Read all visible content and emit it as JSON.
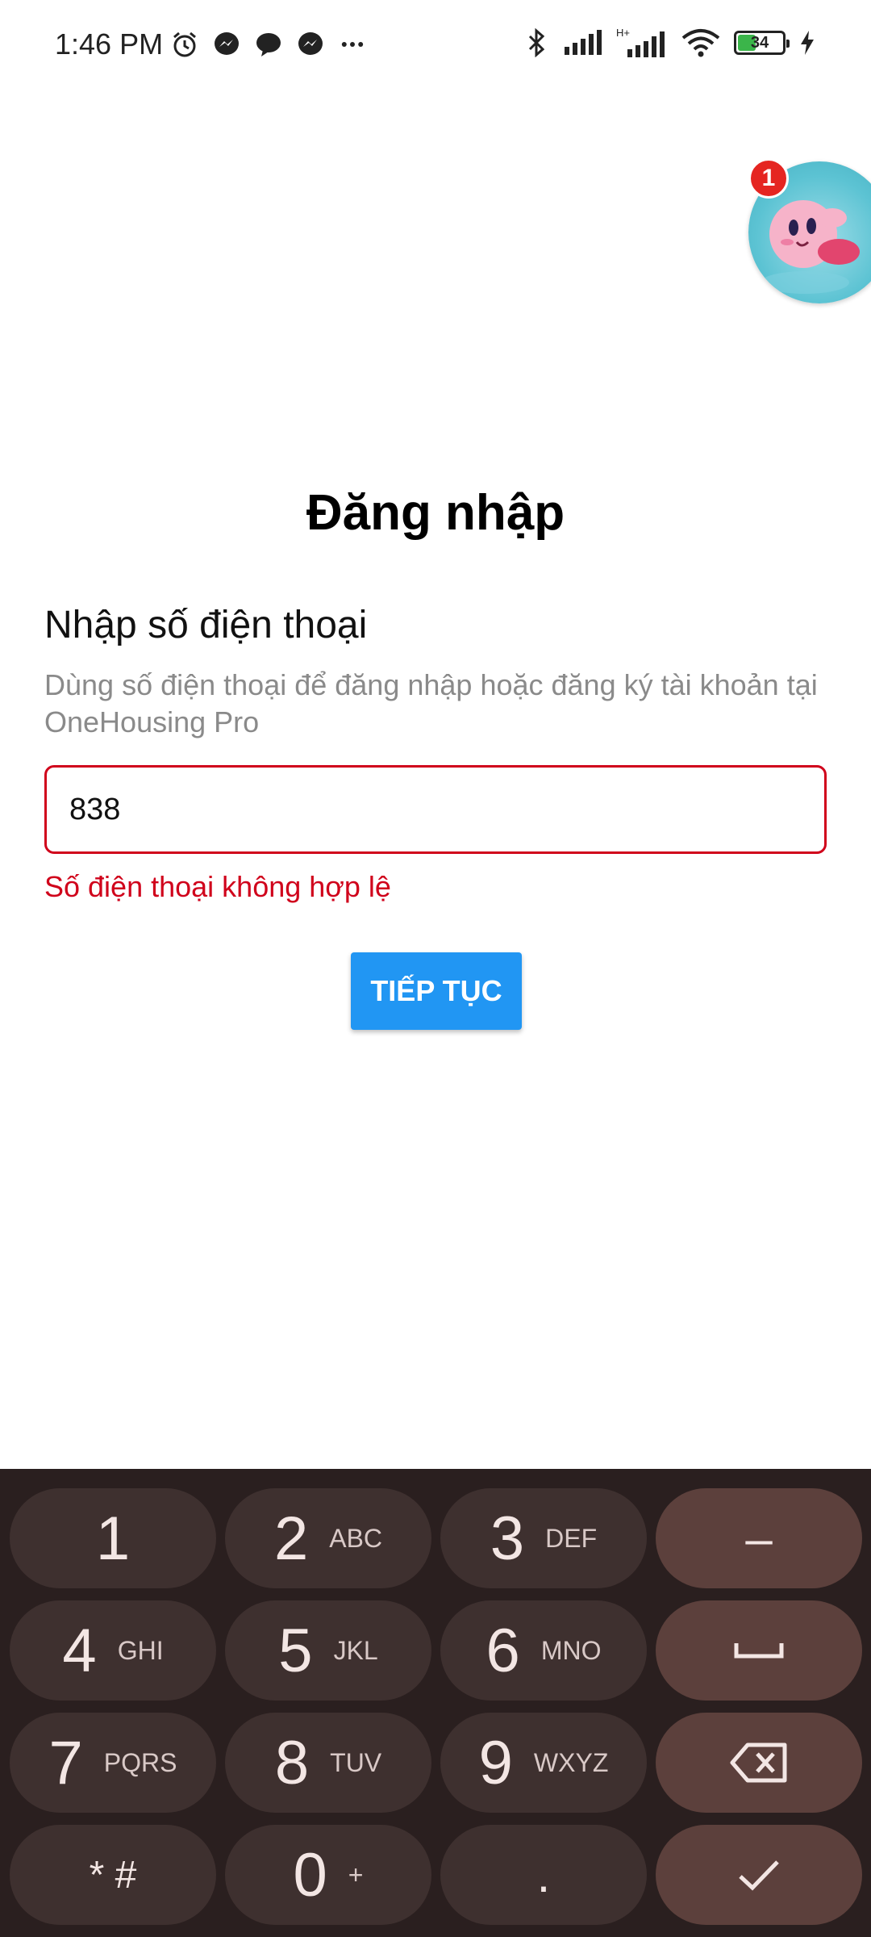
{
  "status_bar": {
    "time": "1:46 PM",
    "battery": "34",
    "left_icons": [
      "alarm-icon",
      "messenger-icon",
      "chat-icon",
      "messenger-icon",
      "more-icon"
    ],
    "right_icons": [
      "bluetooth-icon",
      "signal-icon",
      "hplus-signal-icon",
      "wifi-icon",
      "battery-icon",
      "charging-icon"
    ]
  },
  "chat_head": {
    "badge": "1"
  },
  "login": {
    "title": "Đăng nhập",
    "label": "Nhập số điện thoại",
    "description": "Dùng số điện thoại để đăng nhập hoặc đăng ký tài khoản tại OneHousing Pro",
    "phone_value": "838",
    "error": "Số điện thoại không hợp lệ",
    "continue_label": "TIẾP TỤC"
  },
  "colors": {
    "accent": "#2196f3",
    "error": "#d0021b",
    "keyboard_bg": "#2a1f1f",
    "key_bg": "#3e302f",
    "function_key_bg": "#5c403c"
  },
  "keyboard": {
    "keys": [
      {
        "num": "1",
        "sub": ""
      },
      {
        "num": "2",
        "sub": "ABC"
      },
      {
        "num": "3",
        "sub": "DEF"
      },
      {
        "num": "–",
        "sub": ""
      },
      {
        "num": "4",
        "sub": "GHI"
      },
      {
        "num": "5",
        "sub": "JKL"
      },
      {
        "num": "6",
        "sub": "MNO"
      },
      {
        "num": "␣",
        "sub": ""
      },
      {
        "num": "7",
        "sub": "PQRS"
      },
      {
        "num": "8",
        "sub": "TUV"
      },
      {
        "num": "9",
        "sub": "WXYZ"
      },
      {
        "num": "⌫",
        "sub": ""
      },
      {
        "num": "* #",
        "sub": ""
      },
      {
        "num": "0",
        "sub": "+"
      },
      {
        "num": ".",
        "sub": ""
      },
      {
        "num": "✓",
        "sub": ""
      }
    ]
  }
}
